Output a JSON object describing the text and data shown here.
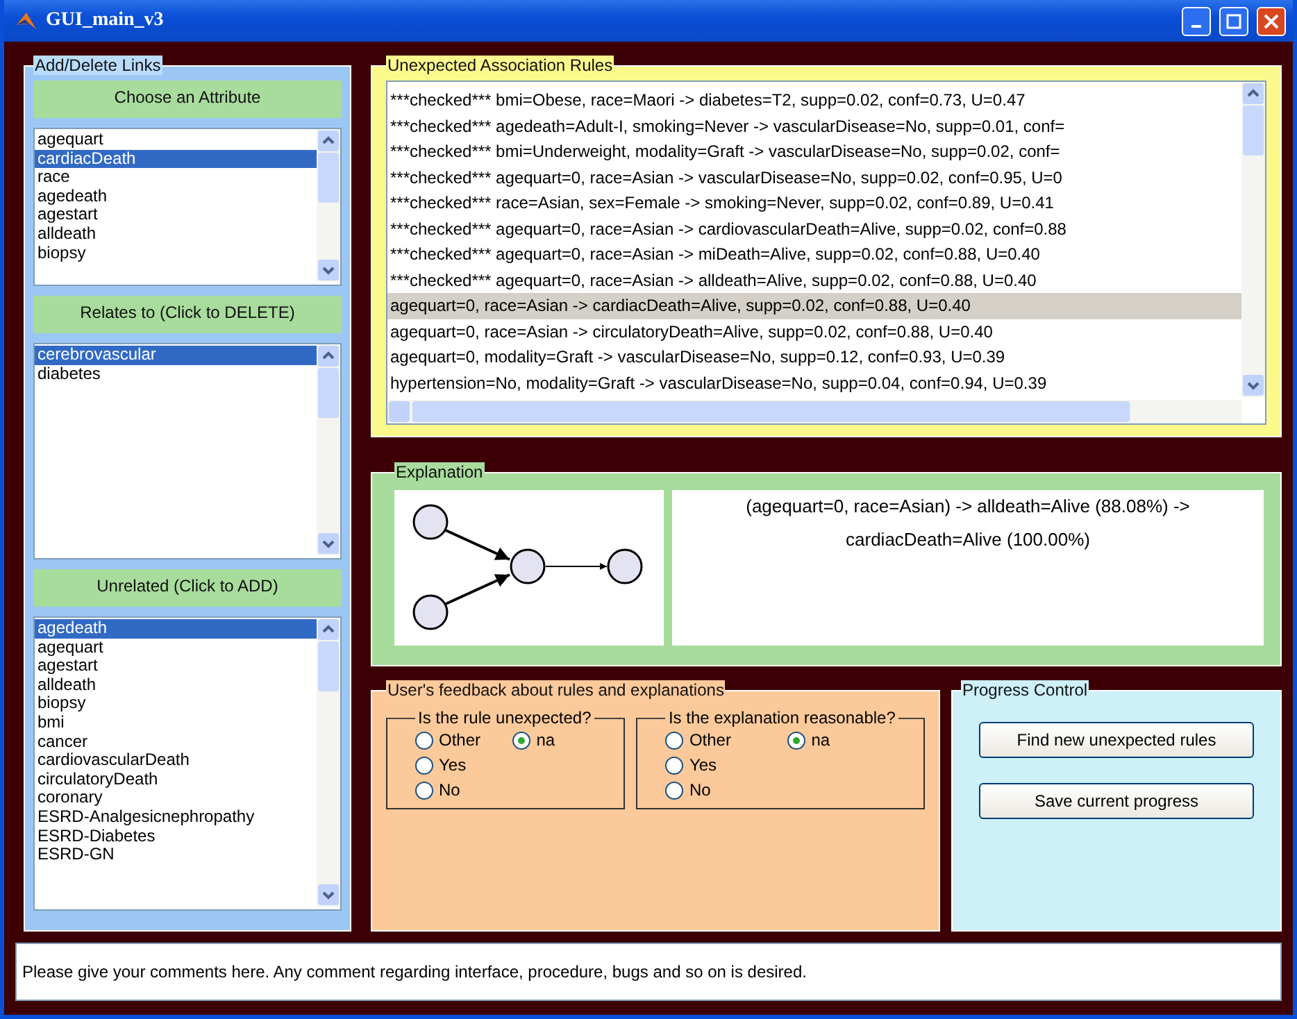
{
  "window": {
    "title": "GUI_main_v3"
  },
  "links_panel": {
    "title": "Add/Delete Links",
    "lists": [
      {
        "header": "Choose an Attribute",
        "items": [
          {
            "label": "agequart",
            "selected": false
          },
          {
            "label": "cardiacDeath",
            "selected": true
          },
          {
            "label": "race",
            "selected": false
          },
          {
            "label": "agedeath",
            "selected": false
          },
          {
            "label": "agestart",
            "selected": false
          },
          {
            "label": "alldeath",
            "selected": false
          },
          {
            "label": "biopsy",
            "selected": false
          }
        ]
      },
      {
        "header": "Relates to (Click to DELETE)",
        "items": [
          {
            "label": "cerebrovascular",
            "selected": true
          },
          {
            "label": "diabetes",
            "selected": false
          }
        ]
      },
      {
        "header": "Unrelated (Click to ADD)",
        "items": [
          {
            "label": "agedeath",
            "selected": true
          },
          {
            "label": "agequart",
            "selected": false
          },
          {
            "label": "agestart",
            "selected": false
          },
          {
            "label": "alldeath",
            "selected": false
          },
          {
            "label": "biopsy",
            "selected": false
          },
          {
            "label": "bmi",
            "selected": false
          },
          {
            "label": "cancer",
            "selected": false
          },
          {
            "label": "cardiovascularDeath",
            "selected": false
          },
          {
            "label": "circulatoryDeath",
            "selected": false
          },
          {
            "label": "coronary",
            "selected": false
          },
          {
            "label": "ESRD-Analgesicnephropathy",
            "selected": false
          },
          {
            "label": "ESRD-Diabetes",
            "selected": false
          },
          {
            "label": "ESRD-GN",
            "selected": false
          }
        ]
      }
    ]
  },
  "rules_panel": {
    "title": "Unexpected Association Rules",
    "rules": [
      {
        "text": "***checked*** bmi=Obese, race=Maori -> diabetes=T2, supp=0.02, conf=0.73, U=0.47",
        "selected": false
      },
      {
        "text": "***checked*** agedeath=Adult-I, smoking=Never -> vascularDisease=No, supp=0.01, conf=",
        "selected": false
      },
      {
        "text": "***checked*** bmi=Underweight, modality=Graft -> vascularDisease=No, supp=0.02, conf=",
        "selected": false
      },
      {
        "text": "***checked*** agequart=0, race=Asian -> vascularDisease=No, supp=0.02, conf=0.95, U=0",
        "selected": false
      },
      {
        "text": "***checked*** race=Asian, sex=Female -> smoking=Never, supp=0.02, conf=0.89, U=0.41",
        "selected": false
      },
      {
        "text": "***checked*** agequart=0, race=Asian -> cardiovascularDeath=Alive, supp=0.02, conf=0.88",
        "selected": false
      },
      {
        "text": "***checked*** agequart=0, race=Asian -> miDeath=Alive, supp=0.02, conf=0.88, U=0.40",
        "selected": false
      },
      {
        "text": "***checked*** agequart=0, race=Asian -> alldeath=Alive, supp=0.02, conf=0.88, U=0.40",
        "selected": false
      },
      {
        "text": "agequart=0, race=Asian -> cardiacDeath=Alive, supp=0.02, conf=0.88, U=0.40",
        "selected": true
      },
      {
        "text": "agequart=0, race=Asian -> circulatoryDeath=Alive, supp=0.02, conf=0.88, U=0.40",
        "selected": false
      },
      {
        "text": "agequart=0, modality=Graft -> vascularDisease=No, supp=0.12, conf=0.93, U=0.39",
        "selected": false
      },
      {
        "text": "hypertension=No, modality=Graft -> vascularDisease=No, supp=0.04, conf=0.94, U=0.39",
        "selected": false
      }
    ]
  },
  "explanation_panel": {
    "title": "Explanation",
    "text": "(agequart=0, race=Asian) -> alldeath=Alive (88.08%) -> cardiacDeath=Alive (100.00%)"
  },
  "feedback_panel": {
    "title": "User's feedback about rules and explanations",
    "groups": [
      {
        "title": "Is the rule unexpected?",
        "options": [
          {
            "label": "Other",
            "selected": false
          },
          {
            "label": "na",
            "selected": true
          },
          {
            "label": "Yes",
            "selected": false
          },
          {
            "label": "No",
            "selected": false
          }
        ]
      },
      {
        "title": "Is the explanation reasonable?",
        "options": [
          {
            "label": "Other",
            "selected": false
          },
          {
            "label": "na",
            "selected": true
          },
          {
            "label": "Yes",
            "selected": false
          },
          {
            "label": "No",
            "selected": false
          }
        ]
      }
    ]
  },
  "progress_panel": {
    "title": "Progress Control",
    "buttons": [
      "Find new unexpected rules",
      "Save current progress"
    ]
  },
  "comment": {
    "value": "Please give your comments here. Any comment regarding interface, procedure, bugs and so on is desired."
  }
}
